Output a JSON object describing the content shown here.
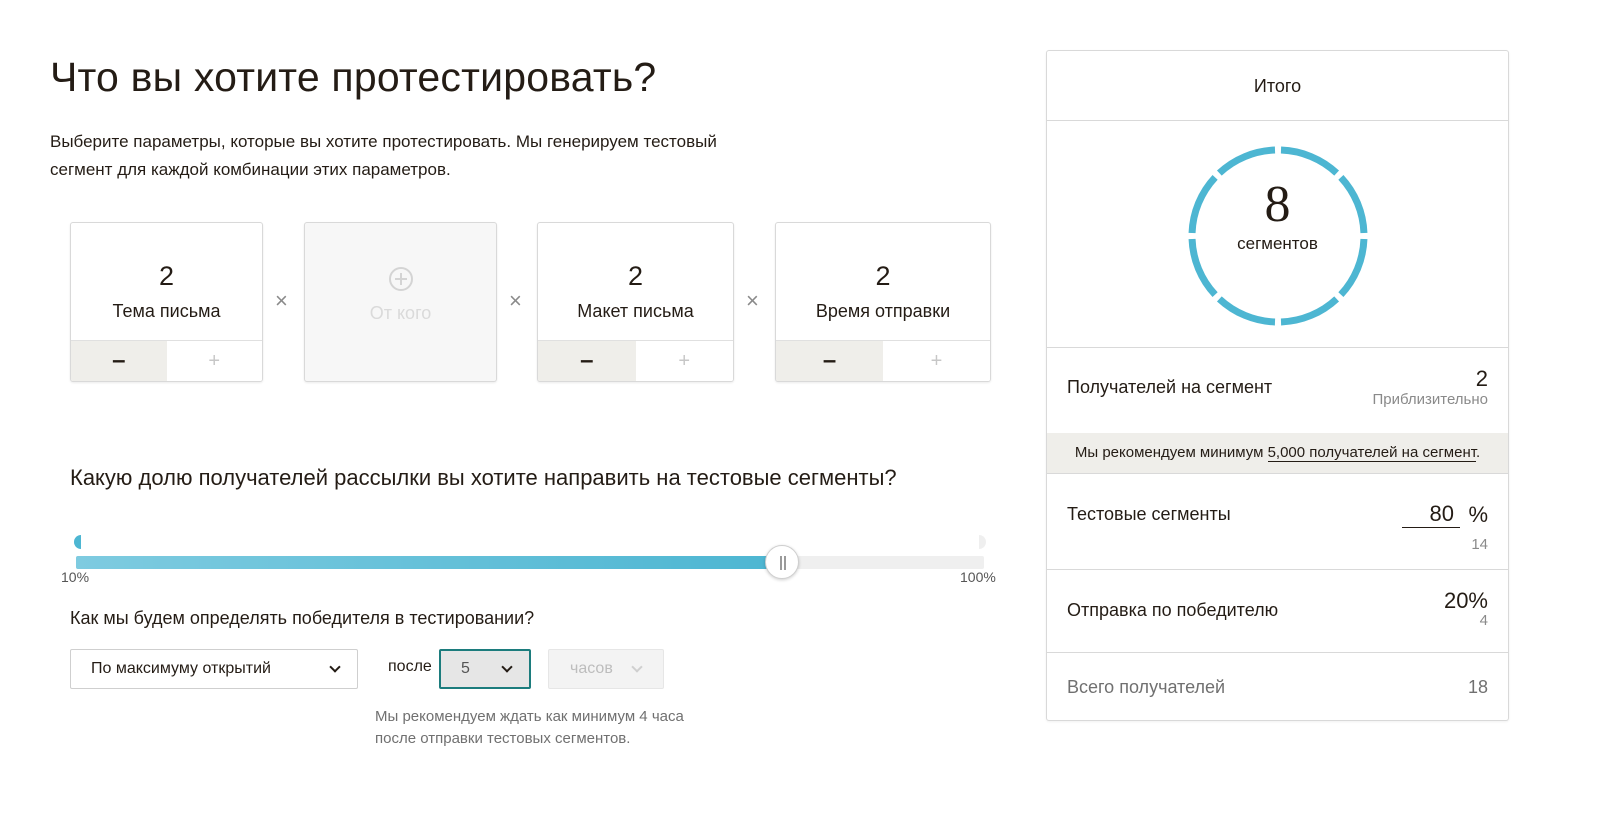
{
  "header": {
    "title": "Что вы хотите протестировать?",
    "intro": "Выберите параметры, которые вы хотите протестировать. Мы генерируем тестовый сегмент для каждой комбинации этих параметров."
  },
  "variables": [
    {
      "count": "2",
      "label": "Тема письма",
      "minus": "–",
      "plus": "+"
    },
    {
      "count": "",
      "label": "От кого",
      "minus": "",
      "plus": ""
    },
    {
      "count": "2",
      "label": "Макет письма",
      "minus": "–",
      "plus": "+"
    },
    {
      "count": "2",
      "label": "Время отправки",
      "minus": "–",
      "plus": "+"
    }
  ],
  "multiply_sign": "×",
  "distribution": {
    "question": "Какую долю получателей рассылки вы хотите направить на тестовые сегменты?",
    "min_label": "10%",
    "max_label": "100%",
    "min": 10,
    "max": 100,
    "value": 80
  },
  "winner": {
    "question": "Как мы будем определять победителя в тестировании?",
    "metric_selected": "По максимуму открытий",
    "after_label": "после",
    "wait_value": "5",
    "wait_unit": "часов",
    "hint": "Мы рекомендуем ждать как минимум 4 часа после отправки тестовых сегментов."
  },
  "summary": {
    "title": "Итого",
    "segments_count": "8",
    "segments_label": "сегментов",
    "per_segment_label": "Получателей на сегмент",
    "per_segment_value": "2",
    "per_segment_note": "Приблизительно",
    "recommend_prefix": "Мы рекомендуем минимум ",
    "recommend_link": "5,000 получателей на сегмент",
    "recommend_suffix": ".",
    "test_label": "Тестовые сегменты",
    "test_pct": "80",
    "test_pct_sign": "%",
    "test_count": "14",
    "winner_label": "Отправка по победителю",
    "winner_pct": "20%",
    "winner_count": "4",
    "total_label": "Всего получателей",
    "total_value": "18"
  },
  "colors": {
    "accent": "#4db6d2",
    "focus": "#1c7c7d",
    "text": "#241c15"
  }
}
